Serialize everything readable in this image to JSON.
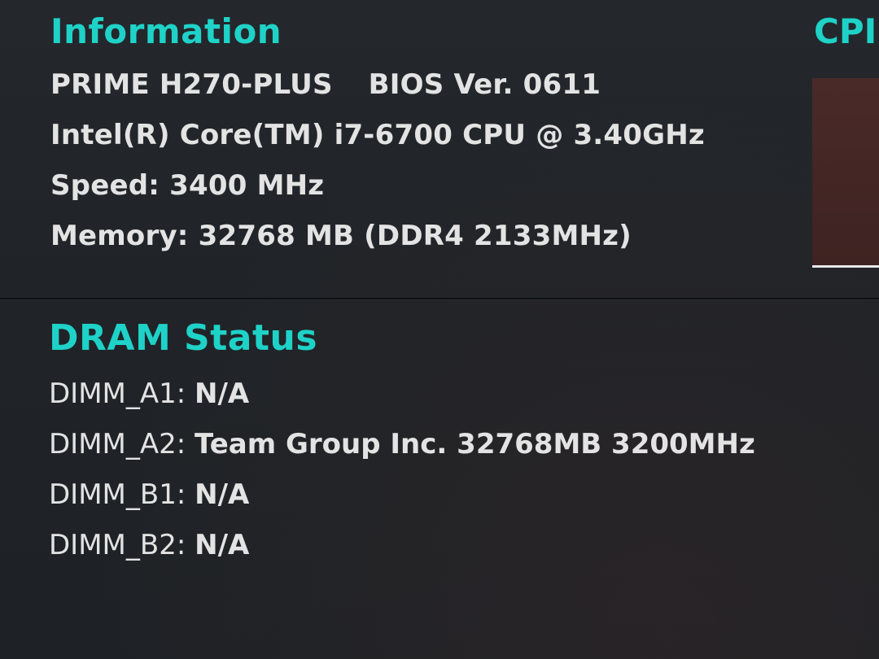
{
  "colors": {
    "accent": "#1fd2c8",
    "text": "#e3e3e3",
    "background": "#1f2327",
    "panel": "#4a2a28"
  },
  "information": {
    "title": "Information",
    "model": "PRIME H270-PLUS",
    "bios": "BIOS Ver. 0611",
    "cpu": "Intel(R) Core(TM) i7-6700 CPU @ 3.40GHz",
    "speed_label": "Speed:",
    "speed_value": "3400 MHz",
    "memory_label": "Memory:",
    "memory_value": "32768 MB (DDR4 2133MHz)"
  },
  "cpu_section": {
    "title": "CPI"
  },
  "dram_status": {
    "title": "DRAM Status",
    "slots": [
      {
        "slot": "DIMM_A1:",
        "value": "N/A"
      },
      {
        "slot": "DIMM_A2:",
        "value": "Team Group Inc. 32768MB 3200MHz"
      },
      {
        "slot": "DIMM_B1:",
        "value": "N/A"
      },
      {
        "slot": "DIMM_B2:",
        "value": "N/A"
      }
    ]
  }
}
